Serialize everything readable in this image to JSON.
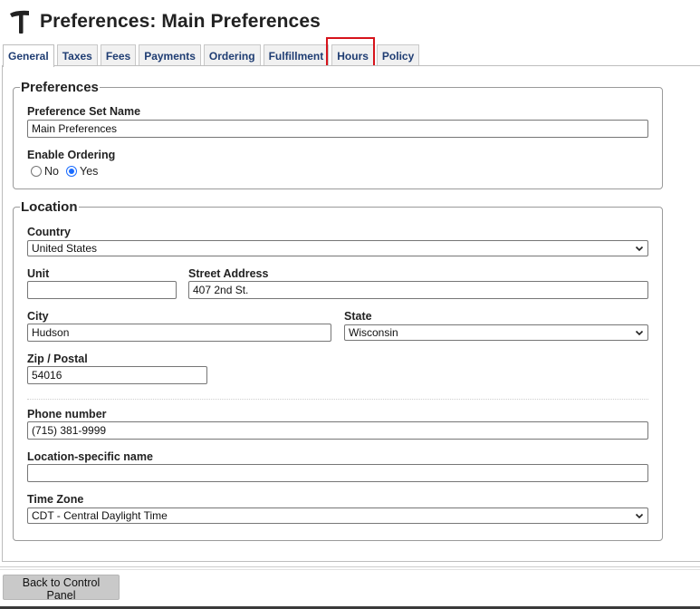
{
  "header": {
    "title": "Preferences: Main Preferences",
    "icon": "hammer-icon"
  },
  "tabs": [
    {
      "label": "General",
      "active": true
    },
    {
      "label": "Taxes"
    },
    {
      "label": "Fees"
    },
    {
      "label": "Payments"
    },
    {
      "label": "Ordering"
    },
    {
      "label": "Fulfillment"
    },
    {
      "label": "Hours",
      "highlighted": true
    },
    {
      "label": "Policy"
    }
  ],
  "preferences": {
    "legend": "Preferences",
    "set_name_label": "Preference Set Name",
    "set_name_value": "Main Preferences",
    "enable_ordering_label": "Enable Ordering",
    "option_no": "No",
    "option_yes": "Yes",
    "enable_ordering_value": "Yes"
  },
  "location": {
    "legend": "Location",
    "country_label": "Country",
    "country_value": "United States",
    "unit_label": "Unit",
    "unit_value": "",
    "street_label": "Street Address",
    "street_value": "407 2nd St.",
    "city_label": "City",
    "city_value": "Hudson",
    "state_label": "State",
    "state_value": "Wisconsin",
    "zip_label": "Zip / Postal",
    "zip_value": "54016",
    "phone_label": "Phone number",
    "phone_value": "(715) 381-9999",
    "loc_name_label": "Location-specific name",
    "loc_name_value": "",
    "timezone_label": "Time Zone",
    "timezone_value": "CDT - Central Daylight Time"
  },
  "footer": {
    "back_label": "Back to Control Panel"
  },
  "colors": {
    "tab_text": "#1f3d73",
    "highlight": "#d6131b",
    "radio_selected": "#1a6cff"
  }
}
